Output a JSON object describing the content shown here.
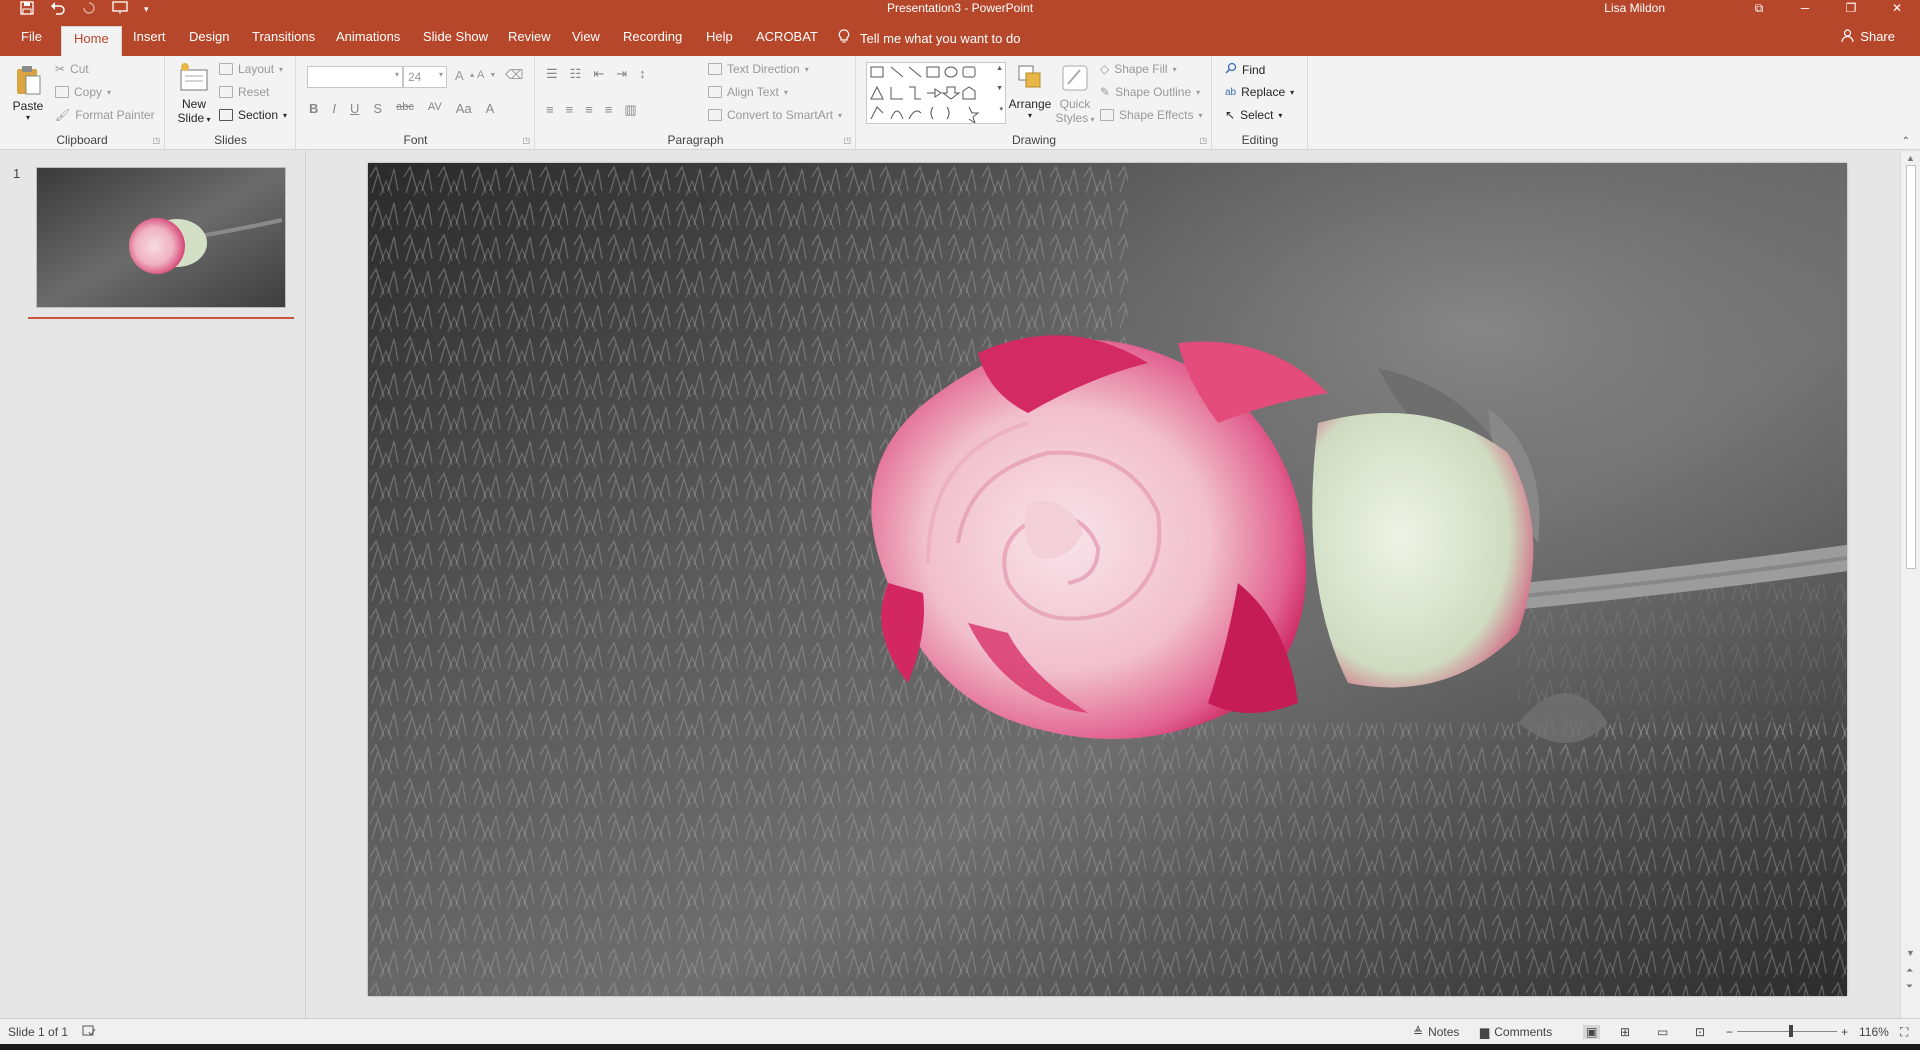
{
  "titlebar": {
    "document_title": "Presentation3  -  PowerPoint",
    "user_name": "Lisa Mildon",
    "qat_icons": [
      "save-icon",
      "undo-icon",
      "redo-icon",
      "start-from-beginning-icon",
      "customize-qat-icon"
    ],
    "window_controls": [
      "ribbon-display-options-icon",
      "minimize-icon",
      "restore-icon",
      "close-icon"
    ]
  },
  "tabs": {
    "file": "File",
    "home": "Home",
    "insert": "Insert",
    "design": "Design",
    "transitions": "Transitions",
    "animations": "Animations",
    "slide_show": "Slide Show",
    "review": "Review",
    "view": "View",
    "recording": "Recording",
    "help": "Help",
    "acrobat": "ACROBAT",
    "tell_me": "Tell me what you want to do",
    "share": "Share",
    "active": "Home"
  },
  "ribbon": {
    "clipboard": {
      "label": "Clipboard",
      "paste": "Paste",
      "cut": "Cut",
      "copy": "Copy",
      "format_painter": "Format Painter"
    },
    "slides": {
      "label": "Slides",
      "new_slide_line1": "New",
      "new_slide_line2": "Slide",
      "layout": "Layout",
      "reset": "Reset",
      "section": "Section"
    },
    "font": {
      "label": "Font",
      "font_name": "",
      "font_size": "24",
      "bold": "B",
      "italic": "I",
      "underline": "U",
      "shadow": "S",
      "strikethrough": "abc",
      "spacing": "AV",
      "change_case": "Aa",
      "font_color": "A",
      "grow": "A",
      "shrink": "A"
    },
    "paragraph": {
      "label": "Paragraph",
      "text_direction": "Text Direction",
      "align_text": "Align Text",
      "convert_smartart": "Convert to SmartArt"
    },
    "drawing": {
      "label": "Drawing",
      "arrange": "Arrange",
      "quick_styles_line1": "Quick",
      "quick_styles_line2": "Styles",
      "shape_fill": "Shape Fill",
      "shape_outline": "Shape Outline",
      "shape_effects": "Shape Effects"
    },
    "editing": {
      "label": "Editing",
      "find": "Find",
      "replace": "Replace",
      "select": "Select"
    }
  },
  "slides_pane": {
    "slide_number": "1"
  },
  "statusbar": {
    "slide_info": "Slide 1 of 1",
    "notes": "Notes",
    "comments": "Comments",
    "zoom": "116%",
    "zoom_level_percent": 116
  },
  "colors": {
    "accent": "#b7472a",
    "ribbon_bg": "#f3f3f3",
    "workspace_bg": "#e6e6e6"
  },
  "slide": {
    "image_subject": "pink-and-white rose on grayscale moss"
  }
}
